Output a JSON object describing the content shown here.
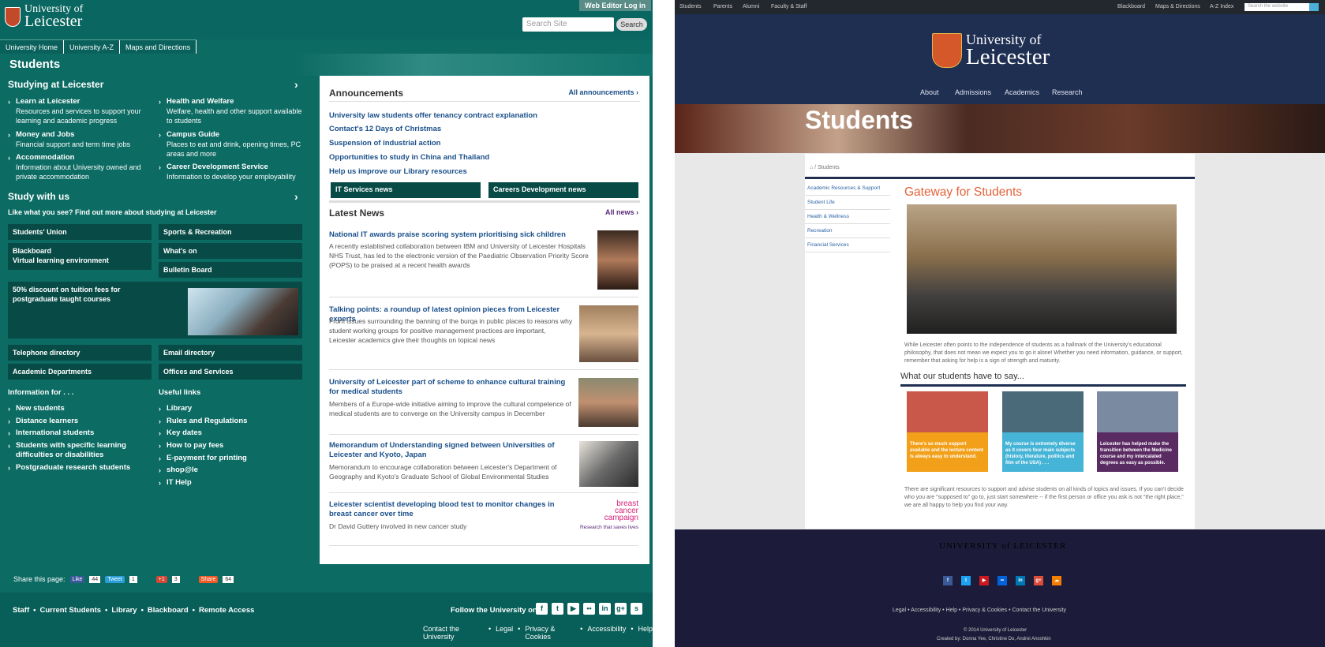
{
  "left": {
    "logo": {
      "line1": "University of",
      "line2": "Leicester"
    },
    "web_editor": "Web Editor Log in",
    "search": {
      "placeholder": "Search Site",
      "button": "Search"
    },
    "top_nav": [
      "University Home",
      "University A-Z",
      "Maps and Directions"
    ],
    "page_title": "Students",
    "studying": {
      "heading": "Studying at Leicester",
      "items": [
        {
          "title": "Learn at Leicester",
          "desc": "Resources and services to support your learning and academic progress"
        },
        {
          "title": "Money and Jobs",
          "desc": "Financial support and term time jobs"
        },
        {
          "title": "Accommodation",
          "desc": "Information about University owned and private accommodation"
        },
        {
          "title": "Health and Welfare",
          "desc": "Welfare, health and other support available to students"
        },
        {
          "title": "Campus Guide",
          "desc": "Places to eat and drink, opening times, PC areas and more"
        },
        {
          "title": "Career Development Service",
          "desc": "Information to develop your employability"
        }
      ]
    },
    "study_with_us": {
      "heading": "Study with us",
      "sub": "Like what you see? Find out more about studying at Leicester"
    },
    "boxes": [
      "Students' Union",
      "Sports & Recreation",
      "Blackboard",
      "Virtual learning environment",
      "What's on",
      "Bulletin Board"
    ],
    "promo": "50% discount on tuition fees for postgraduate taught courses",
    "boxes2": [
      "Telephone directory",
      "Email directory",
      "Academic Departments",
      "Offices and Services"
    ],
    "info_for": {
      "heading": "Information for . . .",
      "items": [
        "New students",
        "Distance learners",
        "International students",
        "Students with specific learning difficulties or disabilities",
        "Postgraduate research students"
      ]
    },
    "useful_links": {
      "heading": "Useful links",
      "items": [
        "Library",
        "Rules and Regulations",
        "Key dates",
        "How to pay fees",
        "E-payment for printing",
        "shop@le",
        "IT Help"
      ]
    },
    "share": {
      "label": "Share this page:",
      "like": "Like",
      "like_count": "44",
      "tweet": "Tweet",
      "tweet_count": "1",
      "gplus": "+1",
      "gplus_count": "3",
      "share_btn": "Share",
      "share_count": "64"
    },
    "footer_links": [
      "Staff",
      "Current Students",
      "Library",
      "Blackboard",
      "Remote Access"
    ],
    "follow": "Follow the University on",
    "footer_links2": [
      "Contact the University",
      "Legal",
      "Privacy & Cookies",
      "Accessibility",
      "Help"
    ]
  },
  "news": {
    "announcements_heading": "Announcements",
    "all_announcements": "All announcements",
    "announcements": [
      "University law students offer tenancy contract explanation",
      "Contact's 12 Days of Christmas",
      "Suspension of industrial action",
      "Opportunities to study in China and Thailand",
      "Help us improve our Library resources"
    ],
    "buttons": [
      "IT Services news",
      "Careers Development news"
    ],
    "latest_heading": "Latest News",
    "all_news": "All news",
    "articles": [
      {
        "title": "National IT awards praise scoring system prioritising sick children",
        "desc": "A recently established collaboration between IBM and University of Leicester Hospitals NHS Trust, has led to the electronic version of the Paediatric Observation Priority Score (POPS) to be praised at a recent health awards"
      },
      {
        "title": "Talking points: a roundup of latest opinion pieces from Leicester experts",
        "desc": "From issues surrounding the banning of the burqa in public places to reasons why student working groups for positive management practices are important, Leicester academics give their thoughts on topical news"
      },
      {
        "title": "University of Leicester part of scheme to enhance cultural training for medical students",
        "desc": "Members of a Europe-wide initiative aiming to improve the cultural competence of medical students are to converge on the University campus in December"
      },
      {
        "title": "Memorandum of Understanding signed between Universities of Leicester and Kyoto, Japan",
        "desc": "Memorandum to encourage collaboration between Leicester's Department of Geography and Kyoto's Graduate School of Global Environmental Studies"
      },
      {
        "title": "Leicester scientist developing blood test to monitor changes in breast cancer over time",
        "desc": "Dr David Guttery involved in new cancer study"
      }
    ],
    "bcc": {
      "l1": "breast",
      "l2": "cancer",
      "l3": "campaign",
      "tag": "Research that saves lives"
    }
  },
  "right": {
    "top_left": [
      "Students",
      "Parents",
      "Alumni",
      "Faculty & Staff"
    ],
    "top_right": [
      "Blackboard",
      "Maps & Directions",
      "A-Z Index"
    ],
    "search_placeholder": "Search the website",
    "logo": {
      "line1": "University of",
      "line2": "Leicester"
    },
    "nav": [
      "About",
      "Admissions",
      "Academics",
      "Research"
    ],
    "banner": "Students",
    "breadcrumb": "Students",
    "side": [
      "Academic Resources & Support",
      "Student Life",
      "Health & Wellness",
      "Recreation",
      "Financial Services"
    ],
    "title": "Gateway for Students",
    "para1": "While Leicester often points to the independence of students as a hallmark of the University's educational philosophy, that does not mean we expect you to go it alone! Whether you need information, guidance, or support, remember that asking for help is a sign of strength and maturity.",
    "subheading": "What our students have to say...",
    "quotes": [
      {
        "text": "There's so much support available and the lecture content is always easy to understand.",
        "color": "#f2a019"
      },
      {
        "text": "My course is extremely diverse as it covers four main subjects (history, literature, politics and film of the USA) . . .",
        "color": "#46b4d6"
      },
      {
        "text": "Leicester has helped make the transition between the Medicine course and my intercalated degrees as easy as possible.",
        "color": "#5a2a63"
      }
    ],
    "para2": "There are significant resources to support and advise students on all kinds of topics and issues. If you can't decide who you are \"supposed to\" go to, just start somewhere -- if the first person or office you ask is not \"the right place,\" we are all happy to help you find your way.",
    "footer_name": "UNIVERSITY of LEICESTER",
    "footer_links": [
      "Legal",
      "Accessibility",
      "Help",
      "Privacy & Cookies",
      "Contact the University"
    ],
    "copyright": "© 2014 University of Leicester",
    "credits": "Created by: Donna Yee, Christine Do, Andrei Anoshkin"
  }
}
